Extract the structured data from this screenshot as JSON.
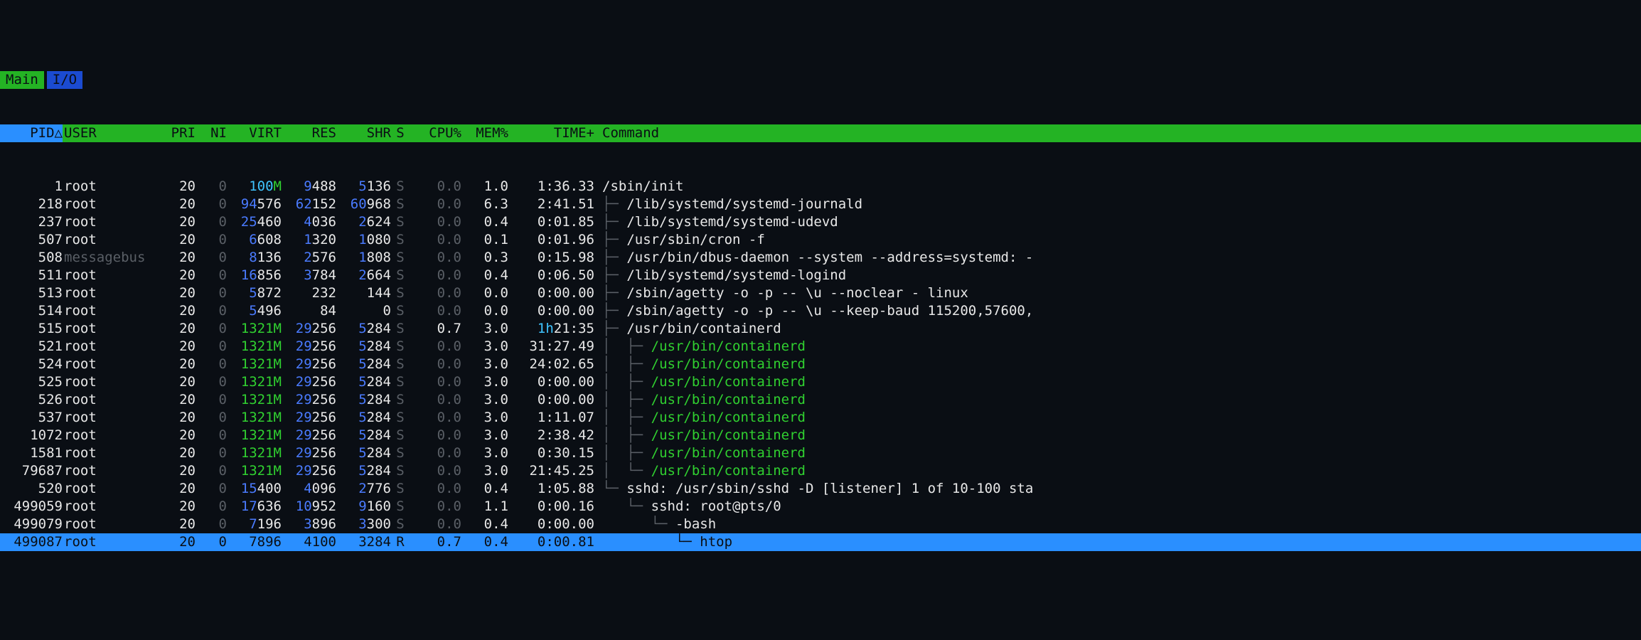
{
  "tabs": {
    "main": "Main",
    "io": "I/O"
  },
  "sort_arrow": "△",
  "columns": {
    "pid": "PID",
    "user": "USER",
    "pri": "PRI",
    "ni": "NI",
    "virt": "VIRT",
    "res": "RES",
    "shr": "SHR",
    "s": "S",
    "cpu": "CPU%",
    "mem": "MEM%",
    "time": "TIME+",
    "cmd": "Command"
  },
  "processes": [
    {
      "pid": "1",
      "user": "root",
      "pri": "20",
      "ni": "0",
      "virt_b": "100",
      "virt_g": "M",
      "res_b": "9",
      "res_w": "488",
      "shr_b": "5",
      "shr_w": "136",
      "s": "S",
      "cpu": "0.0",
      "mem": "1.0",
      "time": "1:36.33",
      "tree": "",
      "cmd": "/sbin/init",
      "thread": false,
      "selected": false,
      "user_dim": false
    },
    {
      "pid": "218",
      "user": "root",
      "pri": "20",
      "ni": "0",
      "virt_b": "94",
      "virt_g": "",
      "virt_w": "576",
      "res_b": "62",
      "res_w": "152",
      "shr_b": "60",
      "shr_w": "968",
      "s": "S",
      "cpu": "0.0",
      "mem": "6.3",
      "time": "2:41.51",
      "tree": "├─ ",
      "cmd": "/lib/systemd/systemd-journald",
      "thread": false,
      "selected": false,
      "user_dim": false
    },
    {
      "pid": "237",
      "user": "root",
      "pri": "20",
      "ni": "0",
      "virt_b": "25",
      "virt_g": "",
      "virt_w": "460",
      "res_b": "4",
      "res_w": "036",
      "shr_b": "2",
      "shr_w": "624",
      "s": "S",
      "cpu": "0.0",
      "mem": "0.4",
      "time": "0:01.85",
      "tree": "├─ ",
      "cmd": "/lib/systemd/systemd-udevd",
      "thread": false,
      "selected": false,
      "user_dim": false
    },
    {
      "pid": "507",
      "user": "root",
      "pri": "20",
      "ni": "0",
      "virt_b": "6",
      "virt_g": "",
      "virt_w": "608",
      "res_b": "1",
      "res_w": "320",
      "shr_b": "1",
      "shr_w": "080",
      "s": "S",
      "cpu": "0.0",
      "mem": "0.1",
      "time": "0:01.96",
      "tree": "├─ ",
      "cmd": "/usr/sbin/cron -f",
      "thread": false,
      "selected": false,
      "user_dim": false
    },
    {
      "pid": "508",
      "user": "messagebus",
      "pri": "20",
      "ni": "0",
      "virt_b": "8",
      "virt_g": "",
      "virt_w": "136",
      "res_b": "2",
      "res_w": "576",
      "shr_b": "1",
      "shr_w": "808",
      "s": "S",
      "cpu": "0.0",
      "mem": "0.3",
      "time": "0:15.98",
      "tree": "├─ ",
      "cmd": "/usr/bin/dbus-daemon --system --address=systemd: -",
      "thread": false,
      "selected": false,
      "user_dim": true
    },
    {
      "pid": "511",
      "user": "root",
      "pri": "20",
      "ni": "0",
      "virt_b": "16",
      "virt_g": "",
      "virt_w": "856",
      "res_b": "3",
      "res_w": "784",
      "shr_b": "2",
      "shr_w": "664",
      "s": "S",
      "cpu": "0.0",
      "mem": "0.4",
      "time": "0:06.50",
      "tree": "├─ ",
      "cmd": "/lib/systemd/systemd-logind",
      "thread": false,
      "selected": false,
      "user_dim": false
    },
    {
      "pid": "513",
      "user": "root",
      "pri": "20",
      "ni": "0",
      "virt_b": "5",
      "virt_g": "",
      "virt_w": "872",
      "res_b": "",
      "res_w": "232",
      "shr_b": "",
      "shr_w": "144",
      "s": "S",
      "cpu": "0.0",
      "mem": "0.0",
      "time": "0:00.00",
      "tree": "├─ ",
      "cmd": "/sbin/agetty -o -p -- \\u --noclear - linux",
      "thread": false,
      "selected": false,
      "user_dim": false
    },
    {
      "pid": "514",
      "user": "root",
      "pri": "20",
      "ni": "0",
      "virt_b": "5",
      "virt_g": "",
      "virt_w": "496",
      "res_b": "",
      "res_w": "84",
      "shr_b": "",
      "shr_w": "0",
      "s": "S",
      "cpu": "0.0",
      "mem": "0.0",
      "time": "0:00.00",
      "tree": "├─ ",
      "cmd": "/sbin/agetty -o -p -- \\u --keep-baud 115200,57600,",
      "thread": false,
      "selected": false,
      "user_dim": false
    },
    {
      "pid": "515",
      "user": "root",
      "pri": "20",
      "ni": "0",
      "virt_b": "",
      "virt_g": "1321M",
      "virt_w": "",
      "res_b": "29",
      "res_w": "256",
      "shr_b": "5",
      "shr_w": "284",
      "s": "S",
      "cpu": "0.7",
      "mem": "3.0",
      "time_c": "1h",
      "time": "21:35",
      "tree": "├─ ",
      "cmd": "/usr/bin/containerd",
      "thread": false,
      "selected": false,
      "user_dim": false
    },
    {
      "pid": "521",
      "user": "root",
      "pri": "20",
      "ni": "0",
      "virt_b": "",
      "virt_g": "1321M",
      "virt_w": "",
      "res_b": "29",
      "res_w": "256",
      "shr_b": "5",
      "shr_w": "284",
      "s": "S",
      "cpu": "0.0",
      "mem": "3.0",
      "time": "31:27.49",
      "tree": "│  ├─ ",
      "cmd": "/usr/bin/containerd",
      "thread": true,
      "selected": false,
      "user_dim": false
    },
    {
      "pid": "524",
      "user": "root",
      "pri": "20",
      "ni": "0",
      "virt_b": "",
      "virt_g": "1321M",
      "virt_w": "",
      "res_b": "29",
      "res_w": "256",
      "shr_b": "5",
      "shr_w": "284",
      "s": "S",
      "cpu": "0.0",
      "mem": "3.0",
      "time": "24:02.65",
      "tree": "│  ├─ ",
      "cmd": "/usr/bin/containerd",
      "thread": true,
      "selected": false,
      "user_dim": false
    },
    {
      "pid": "525",
      "user": "root",
      "pri": "20",
      "ni": "0",
      "virt_b": "",
      "virt_g": "1321M",
      "virt_w": "",
      "res_b": "29",
      "res_w": "256",
      "shr_b": "5",
      "shr_w": "284",
      "s": "S",
      "cpu": "0.0",
      "mem": "3.0",
      "time": "0:00.00",
      "tree": "│  ├─ ",
      "cmd": "/usr/bin/containerd",
      "thread": true,
      "selected": false,
      "user_dim": false
    },
    {
      "pid": "526",
      "user": "root",
      "pri": "20",
      "ni": "0",
      "virt_b": "",
      "virt_g": "1321M",
      "virt_w": "",
      "res_b": "29",
      "res_w": "256",
      "shr_b": "5",
      "shr_w": "284",
      "s": "S",
      "cpu": "0.0",
      "mem": "3.0",
      "time": "0:00.00",
      "tree": "│  ├─ ",
      "cmd": "/usr/bin/containerd",
      "thread": true,
      "selected": false,
      "user_dim": false
    },
    {
      "pid": "537",
      "user": "root",
      "pri": "20",
      "ni": "0",
      "virt_b": "",
      "virt_g": "1321M",
      "virt_w": "",
      "res_b": "29",
      "res_w": "256",
      "shr_b": "5",
      "shr_w": "284",
      "s": "S",
      "cpu": "0.0",
      "mem": "3.0",
      "time": "1:11.07",
      "tree": "│  ├─ ",
      "cmd": "/usr/bin/containerd",
      "thread": true,
      "selected": false,
      "user_dim": false
    },
    {
      "pid": "1072",
      "user": "root",
      "pri": "20",
      "ni": "0",
      "virt_b": "",
      "virt_g": "1321M",
      "virt_w": "",
      "res_b": "29",
      "res_w": "256",
      "shr_b": "5",
      "shr_w": "284",
      "s": "S",
      "cpu": "0.0",
      "mem": "3.0",
      "time": "2:38.42",
      "tree": "│  ├─ ",
      "cmd": "/usr/bin/containerd",
      "thread": true,
      "selected": false,
      "user_dim": false
    },
    {
      "pid": "1581",
      "user": "root",
      "pri": "20",
      "ni": "0",
      "virt_b": "",
      "virt_g": "1321M",
      "virt_w": "",
      "res_b": "29",
      "res_w": "256",
      "shr_b": "5",
      "shr_w": "284",
      "s": "S",
      "cpu": "0.0",
      "mem": "3.0",
      "time": "0:30.15",
      "tree": "│  ├─ ",
      "cmd": "/usr/bin/containerd",
      "thread": true,
      "selected": false,
      "user_dim": false
    },
    {
      "pid": "79687",
      "user": "root",
      "pri": "20",
      "ni": "0",
      "virt_b": "",
      "virt_g": "1321M",
      "virt_w": "",
      "res_b": "29",
      "res_w": "256",
      "shr_b": "5",
      "shr_w": "284",
      "s": "S",
      "cpu": "0.0",
      "mem": "3.0",
      "time": "21:45.25",
      "tree": "│  └─ ",
      "cmd": "/usr/bin/containerd",
      "thread": true,
      "selected": false,
      "user_dim": false
    },
    {
      "pid": "520",
      "user": "root",
      "pri": "20",
      "ni": "0",
      "virt_b": "15",
      "virt_g": "",
      "virt_w": "400",
      "res_b": "4",
      "res_w": "096",
      "shr_b": "2",
      "shr_w": "776",
      "s": "S",
      "cpu": "0.0",
      "mem": "0.4",
      "time": "1:05.88",
      "tree": "└─ ",
      "cmd": "sshd: /usr/sbin/sshd -D [listener] 1 of 10-100 sta",
      "thread": false,
      "selected": false,
      "user_dim": false
    },
    {
      "pid": "499059",
      "user": "root",
      "pri": "20",
      "ni": "0",
      "virt_b": "17",
      "virt_g": "",
      "virt_w": "636",
      "res_b": "10",
      "res_w": "952",
      "shr_b": "9",
      "shr_w": "160",
      "s": "S",
      "cpu": "0.0",
      "mem": "1.1",
      "time": "0:00.16",
      "tree": "   └─ ",
      "cmd": "sshd: root@pts/0",
      "thread": false,
      "selected": false,
      "user_dim": false
    },
    {
      "pid": "499079",
      "user": "root",
      "pri": "20",
      "ni": "0",
      "virt_b": "7",
      "virt_g": "",
      "virt_w": "196",
      "res_b": "3",
      "res_w": "896",
      "shr_b": "3",
      "shr_w": "300",
      "s": "S",
      "cpu": "0.0",
      "mem": "0.4",
      "time": "0:00.00",
      "tree": "      └─ ",
      "cmd": "-bash",
      "thread": false,
      "selected": false,
      "user_dim": false
    },
    {
      "pid": "499087",
      "user": "root",
      "pri": "20",
      "ni": "0",
      "virt_b": "7",
      "virt_g": "",
      "virt_w": "896",
      "res_b": "4",
      "res_w": "100",
      "shr_b": "3",
      "shr_w": "284",
      "s": "R",
      "cpu": "0.7",
      "mem": "0.4",
      "time": "0:00.81",
      "tree": "         └─ ",
      "cmd": "htop",
      "thread": false,
      "selected": true,
      "user_dim": false
    }
  ]
}
